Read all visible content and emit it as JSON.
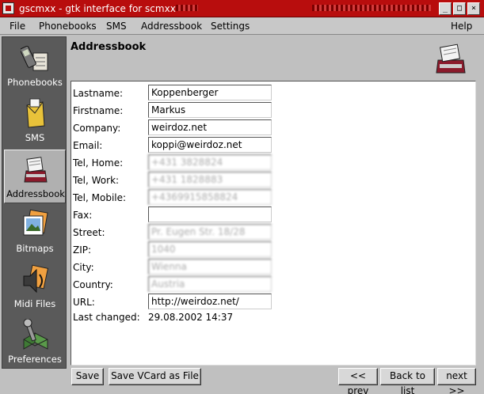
{
  "window": {
    "title": "gscmxx - gtk interface for scmxx",
    "minimize_glyph": "_",
    "maximize_glyph": "□",
    "close_glyph": "×"
  },
  "menubar": {
    "items": [
      "File",
      "Phonebooks",
      "SMS",
      "Addressbook",
      "Settings"
    ],
    "help": "Help"
  },
  "sidebar": {
    "items": [
      {
        "label": "Phonebooks",
        "icon": "phonebook-icon"
      },
      {
        "label": "SMS",
        "icon": "sms-icon"
      },
      {
        "label": "Addressbook",
        "icon": "addressbook-icon"
      },
      {
        "label": "Bitmaps",
        "icon": "bitmaps-icon"
      },
      {
        "label": "Midi Files",
        "icon": "midi-icon"
      },
      {
        "label": "Preferences",
        "icon": "preferences-icon"
      }
    ],
    "active": "Addressbook"
  },
  "main": {
    "title": "Addressbook"
  },
  "form": {
    "fields": [
      {
        "label": "Lastname:",
        "value": "Koppenberger"
      },
      {
        "label": "Firstname:",
        "value": "Markus"
      },
      {
        "label": "Company:",
        "value": "weirdoz.net"
      },
      {
        "label": "Email:",
        "value": "koppi@weirdoz.net"
      },
      {
        "label": "Tel, Home:",
        "value": "+431 3828824"
      },
      {
        "label": "Tel, Work:",
        "value": "+431 1828883"
      },
      {
        "label": "Tel, Mobile:",
        "value": "+4369915858824"
      },
      {
        "label": "Fax:",
        "value": ""
      },
      {
        "label": "Street:",
        "value": "Pr. Eugen Str. 18/28"
      },
      {
        "label": "ZIP:",
        "value": "1040"
      },
      {
        "label": "City:",
        "value": "Wienna"
      },
      {
        "label": "Country:",
        "value": "Austria"
      },
      {
        "label": "URL:",
        "value": "http://weirdoz.net/"
      }
    ],
    "last_changed_label": "Last changed:",
    "last_changed_value": "29.08.2002 14:37"
  },
  "buttons": {
    "save": "Save",
    "save_vcard": "Save VCard as File",
    "prev": "<< prev",
    "back": "Back to list",
    "next": "next >>"
  },
  "colors": {
    "titlebar": "#b80d0d",
    "sidebar": "#5a5a5a"
  }
}
